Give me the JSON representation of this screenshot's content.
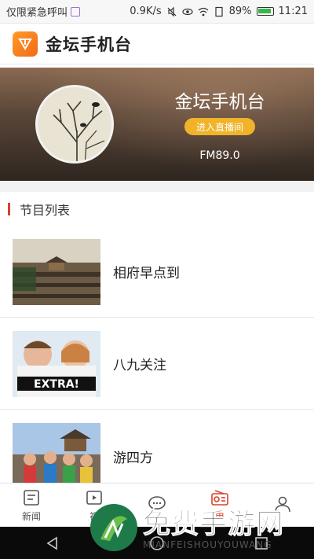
{
  "statusbar": {
    "carrier": "仅限紧急呼叫",
    "speed": "0.9K/s",
    "battery": "89%",
    "time": "11:21"
  },
  "app": {
    "title": "金坛手机台"
  },
  "banner": {
    "station_name": "金坛手机台",
    "live_button": "进入直播间",
    "frequency": "FM89.0"
  },
  "section": {
    "title": "节目列表"
  },
  "programs": [
    {
      "name": "相府早点到"
    },
    {
      "name": "八九关注"
    },
    {
      "name": "游四方"
    }
  ],
  "bottom_nav": [
    {
      "label": "新闻",
      "icon": "news-icon"
    },
    {
      "label": "视",
      "icon": "video-icon"
    },
    {
      "label": "",
      "icon": "chat-icon"
    },
    {
      "label": "电",
      "icon": "radio-icon"
    },
    {
      "label": "",
      "icon": "user-icon"
    }
  ],
  "watermark": {
    "text": "免费手游网",
    "sub": "MIANFEISHOUYOUWANG"
  },
  "colors": {
    "accent": "#d9412b",
    "logo": "#f26a14",
    "live_button": "#f0b32a"
  }
}
